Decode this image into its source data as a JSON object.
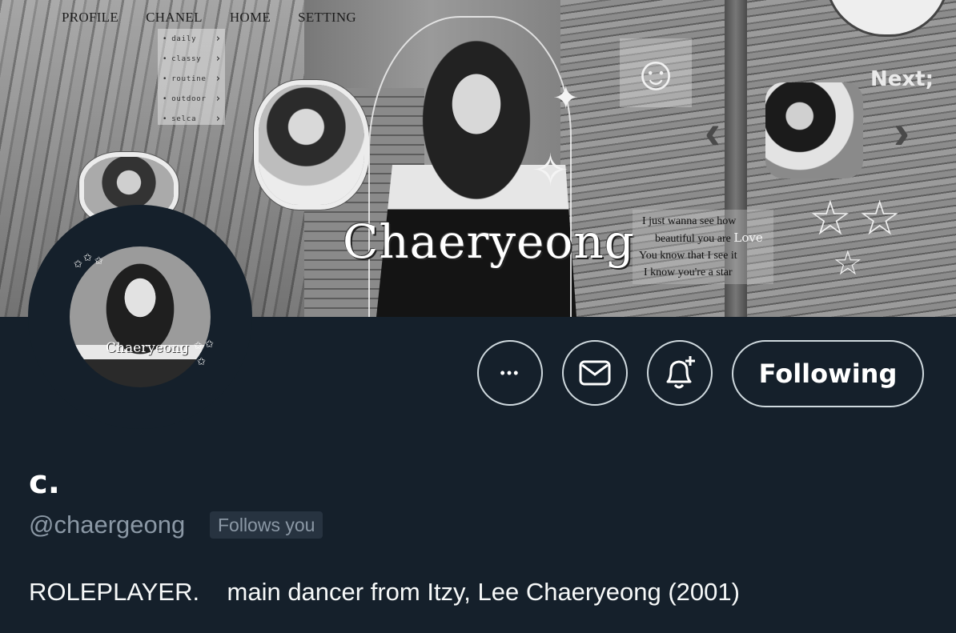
{
  "banner": {
    "nav": [
      "PROFILE",
      "CHANEL",
      "HOME",
      "SETTING"
    ],
    "submenu": [
      "daily",
      "classy",
      "routine",
      "outdoor",
      "selca"
    ],
    "title": "Chaeryeong",
    "next_label": "Next;",
    "lyrics": [
      "I just wanna see how",
      "beautiful you are",
      "You know that I see it",
      "I know you're a star"
    ],
    "lyrics_love": "Love",
    "smiley_glyph": "☺",
    "chevron_left": "‹",
    "chevron_right": "›"
  },
  "avatar": {
    "caption": "Chaeryeong"
  },
  "actions": {
    "more_glyph": "•••",
    "follow_label": "Following"
  },
  "profile": {
    "display_name": "c.",
    "handle": "@chaergeong",
    "follows_you": "Follows you",
    "bio": "ROLEPLAYER.    main dancer from Itzy, Lee Chaeryeong (2001)"
  },
  "colors": {
    "background": "#15202b",
    "secondary_text": "#8b98a5",
    "button_border": "#cfd9de",
    "badge_bg": "#273340"
  },
  "icons": [
    "more-icon",
    "mail-icon",
    "notification-bell-plus-icon"
  ]
}
